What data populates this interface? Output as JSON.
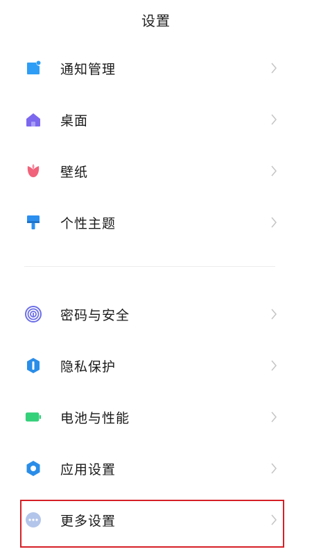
{
  "header": {
    "title": "设置"
  },
  "group1": [
    {
      "label": "通知管理",
      "icon": "notification-icon"
    },
    {
      "label": "桌面",
      "icon": "home-icon"
    },
    {
      "label": "壁纸",
      "icon": "tulip-icon"
    },
    {
      "label": "个性主题",
      "icon": "brush-icon"
    }
  ],
  "group2": [
    {
      "label": "密码与安全",
      "icon": "fingerprint-icon"
    },
    {
      "label": "隐私保护",
      "icon": "privacy-icon"
    },
    {
      "label": "电池与性能",
      "icon": "battery-icon"
    },
    {
      "label": "应用设置",
      "icon": "gear-icon"
    },
    {
      "label": "更多设置",
      "icon": "more-dots-icon"
    }
  ],
  "colors": {
    "notification": "#2e9df5",
    "home": "#7b68ee",
    "tulip": "#f0637a",
    "brush": "#2b8ff0",
    "fingerprint": "#6c6ee8",
    "privacy": "#2a8de8",
    "battery": "#34d07a",
    "gear": "#2a8de8",
    "more": "#b3c5ea",
    "highlight": "#d51f26"
  }
}
